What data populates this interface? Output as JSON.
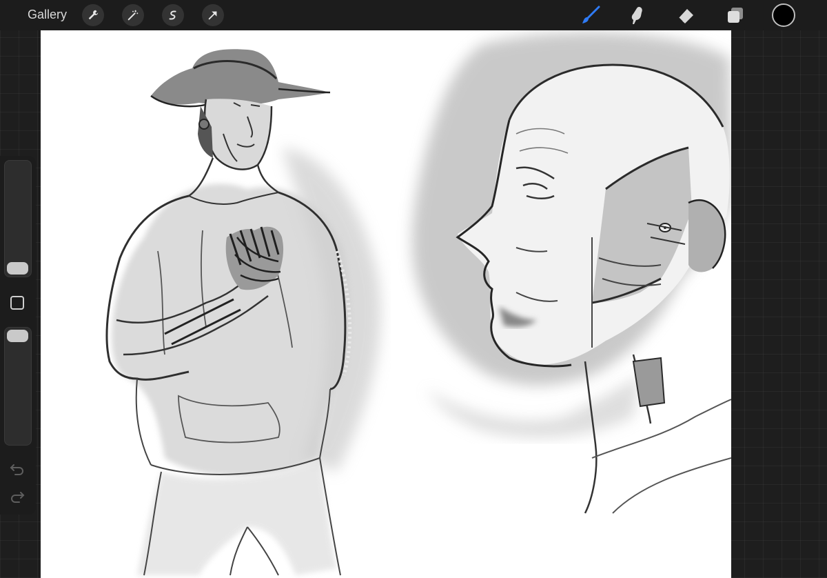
{
  "topbar": {
    "gallery_label": "Gallery",
    "left_tools": [
      "wrench-icon",
      "magic-wand-icon",
      "selection-icon",
      "transform-arrow-icon"
    ],
    "right_tools": [
      "brush-icon",
      "smudge-icon",
      "eraser-icon",
      "layers-icon"
    ],
    "active_tool": "brush-icon",
    "current_color": "#000000",
    "accent_color": "#2f7bf5"
  },
  "sidebar": {
    "brush_size_level": 0.0,
    "opacity_level": 1.0,
    "tools": [
      "modify-square-icon",
      "undo-icon",
      "redo-icon"
    ]
  },
  "canvas": {
    "background": "#ffffff",
    "content": "pencil-sketches"
  }
}
